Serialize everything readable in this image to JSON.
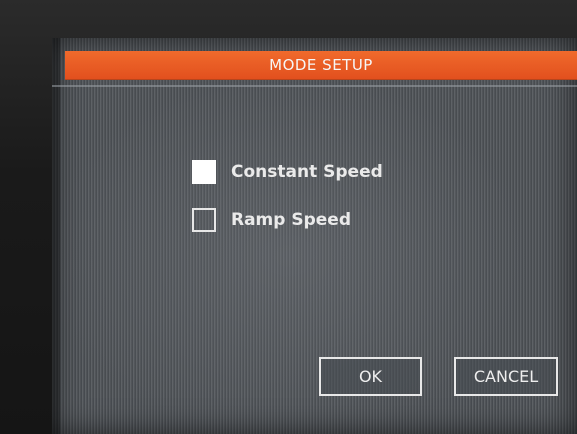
{
  "dialog": {
    "title": "MODE SETUP",
    "options": [
      {
        "label": "Constant Speed",
        "checked": true
      },
      {
        "label": "Ramp Speed",
        "checked": false
      }
    ],
    "buttons": {
      "ok": "OK",
      "cancel": "CANCEL"
    }
  },
  "colors": {
    "title_bar": "#e2501e",
    "screen_bg": "#4c5055",
    "text": "#eaeaea"
  }
}
